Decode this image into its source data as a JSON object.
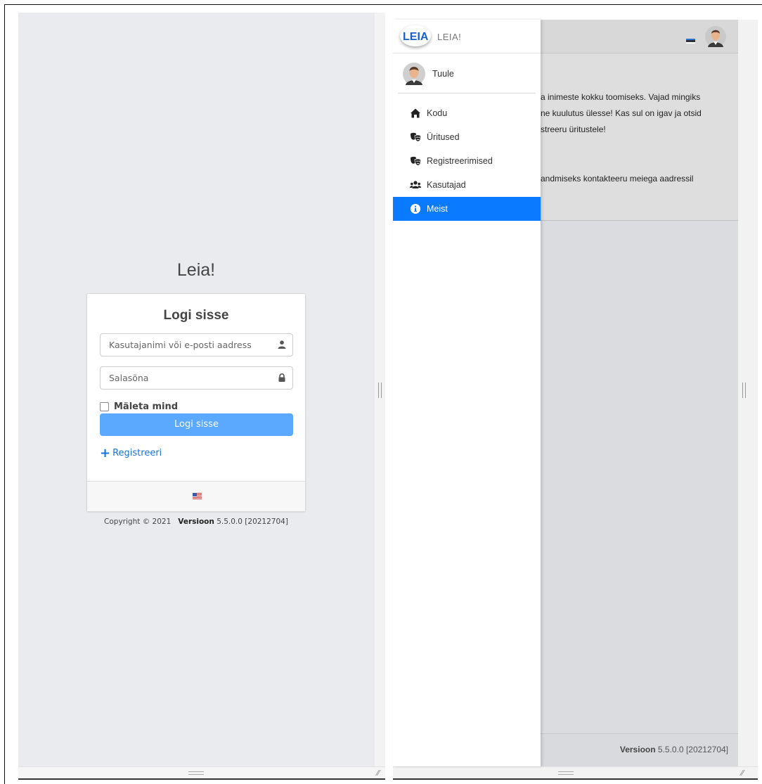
{
  "login": {
    "brand": "Leia!",
    "title": "Logi sisse",
    "username_placeholder": "Kasutajanimi või e-posti aadress",
    "password_placeholder": "Salasõna",
    "remember_label": "Mäleta mind",
    "submit_label": "Logi sisse",
    "register_label": "Registreeri",
    "flag_icon": "us-flag-icon",
    "copyright_prefix": "Copyright © 2021",
    "version_label": "Versioon",
    "version_value": "5.5.0.0 [20212704]"
  },
  "app": {
    "brand": "LEIA!",
    "logo_text": "LEIA",
    "user_name": "Tuule",
    "nav": [
      {
        "label": "Kodu",
        "icon": "home-icon"
      },
      {
        "label": "Üritused",
        "icon": "masks-icon"
      },
      {
        "label": "Registreerimised",
        "icon": "masks-icon"
      },
      {
        "label": "Kasutajad",
        "icon": "users-icon"
      },
      {
        "label": "Meist",
        "icon": "info-icon",
        "active": true
      }
    ],
    "content_lines": [
      "a inimeste kokku toomiseks. Vajad mingiks",
      "ne kuulutus ülesse! Kas sul on igav ja otsid",
      "streeru üritustele!",
      "andmiseks kontakteeru meiega aadressil"
    ],
    "footer_version_label": "Versioon",
    "footer_version_value": "5.5.0.0 [20212704]",
    "accent_color": "#0a7bff"
  }
}
